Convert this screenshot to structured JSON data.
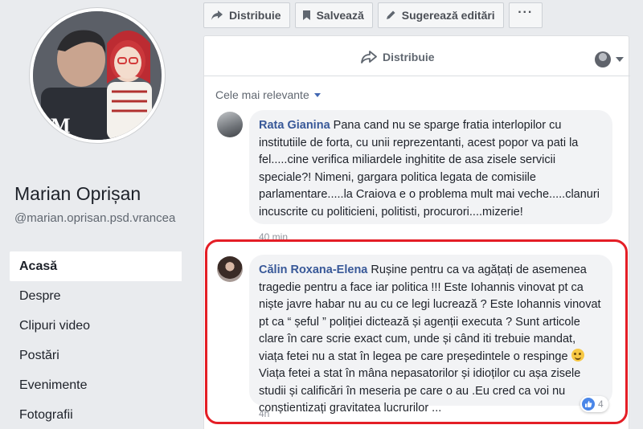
{
  "left": {
    "page_name": "Marian Oprișan",
    "page_handle": "@marian.oprisan.psd.vrancea",
    "avatar_monogram": "M",
    "nav": [
      {
        "label": "Acasă",
        "active": true
      },
      {
        "label": "Despre",
        "active": false
      },
      {
        "label": "Clipuri video",
        "active": false
      },
      {
        "label": "Postări",
        "active": false
      },
      {
        "label": "Evenimente",
        "active": false
      },
      {
        "label": "Fotografii",
        "active": false
      }
    ]
  },
  "actions": {
    "share_label": "Distribuie",
    "save_label": "Salvează",
    "suggest_label": "Sugerează editări",
    "more_label": "···"
  },
  "post": {
    "share_label": "Distribuie",
    "sort_label": "Cele mai relevante"
  },
  "comments": [
    {
      "author": "Rata Gianina",
      "text": "Pana cand nu se sparge fratia interlopilor cu institutiile de forta, cu unii reprezentanti, acest popor va pati la fel.....cine verifica miliardele inghitite de asa zisele servicii speciale?! Nimeni, gargara politica legata de comisiile parlamentare.....la Craiova e o problema mult mai veche.....clanuri incuscrite cu politicieni, politisti, procurori....mizerie!",
      "time": "40 min"
    },
    {
      "author": "Călin Roxana-Elena",
      "text_a": "Rușine pentru ca va agățați de asemenea tragedie pentru a face iar politica !!! Este Iohannis vinovat pt ca niște javre habar nu au cu ce legi lucrează ? Este Iohannis vinovat pt ca “ șeful ” poliției dictează și agenții executa ? Sunt articole clare în care scrie exact cum, unde și când iti trebuie mandat, viața fetei nu a stat în legea pe care președintele o respinge",
      "text_b": "Viața fetei a stat în mâna nepasatorilor și idioților cu așa zisele studii și calificări în meseria pe care o au .Eu cred ca voi nu conștientizați gravitatea lucrurilor ...",
      "time": "4h",
      "reaction_count": "4"
    }
  ],
  "colors": {
    "link": "#385898",
    "highlight": "#e41e26",
    "background": "#e9ebee"
  },
  "icons": [
    "share-icon",
    "bookmark-icon",
    "pencil-icon",
    "more-icon",
    "like-icon",
    "caret-down-icon"
  ]
}
